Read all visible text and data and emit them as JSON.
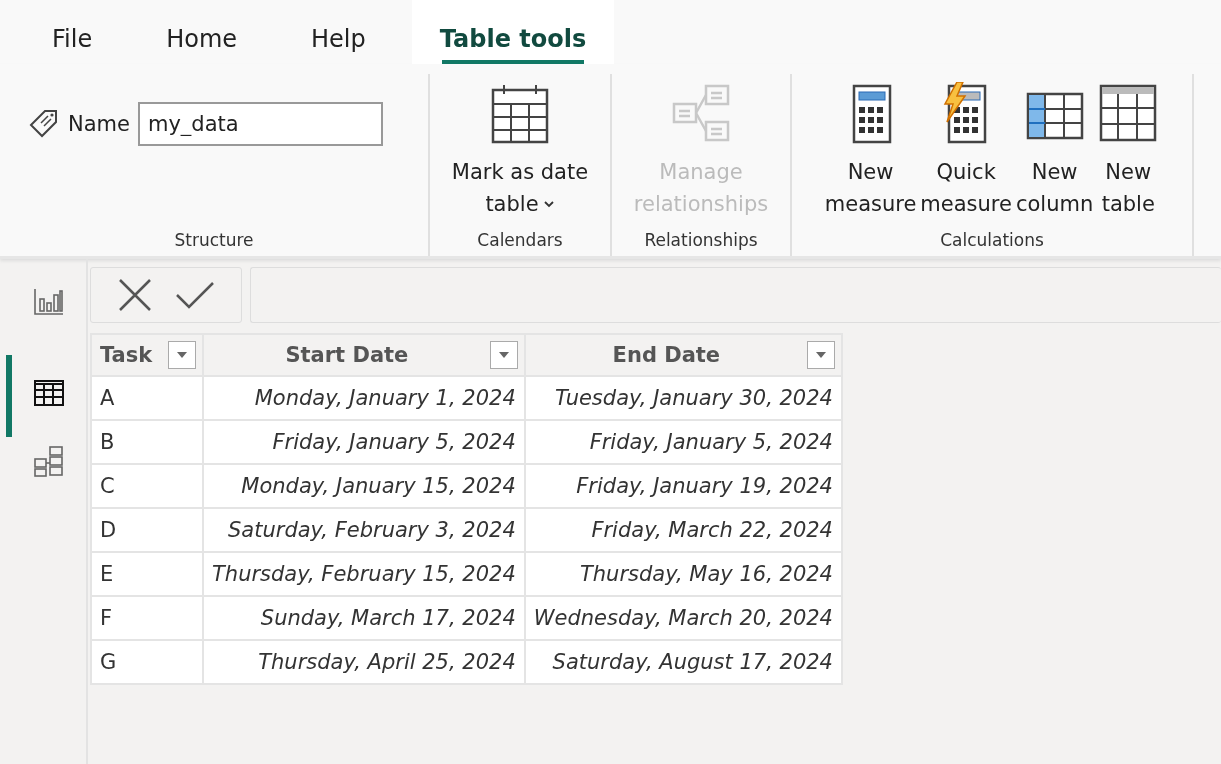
{
  "tabs": [
    {
      "label": "File",
      "selected": false
    },
    {
      "label": "Home",
      "selected": false
    },
    {
      "label": "Help",
      "selected": false
    },
    {
      "label": "Table tools",
      "selected": true
    }
  ],
  "ribbon": {
    "name_label": "Name",
    "name_value": "my_data",
    "groups": [
      {
        "label": "Structure"
      },
      {
        "label": "Calendars",
        "buttons": [
          {
            "kind": "calendar",
            "lines": [
              "Mark as date",
              "table"
            ],
            "dropdown": true,
            "disabled": false
          }
        ]
      },
      {
        "label": "Relationships",
        "buttons": [
          {
            "kind": "relationships",
            "lines": [
              "Manage",
              "relationships"
            ],
            "dropdown": false,
            "disabled": true
          }
        ]
      },
      {
        "label": "Calculations",
        "buttons": [
          {
            "kind": "measure",
            "lines": [
              "New",
              "measure"
            ],
            "dropdown": false,
            "disabled": false
          },
          {
            "kind": "quick-measure",
            "lines": [
              "Quick",
              "measure"
            ],
            "dropdown": false,
            "disabled": false
          },
          {
            "kind": "column",
            "lines": [
              "New",
              "column"
            ],
            "dropdown": false,
            "disabled": false
          },
          {
            "kind": "table",
            "lines": [
              "New",
              "table"
            ],
            "dropdown": false,
            "disabled": false
          }
        ]
      }
    ]
  },
  "nav": [
    {
      "kind": "report",
      "selected": false
    },
    {
      "kind": "table",
      "selected": true
    },
    {
      "kind": "model",
      "selected": false
    }
  ],
  "table": {
    "columns": [
      "Task",
      "Start Date",
      "End Date"
    ],
    "rows": [
      [
        "A",
        "Monday, January 1, 2024",
        "Tuesday, January 30, 2024"
      ],
      [
        "B",
        "Friday, January 5, 2024",
        "Friday, January 5, 2024"
      ],
      [
        "C",
        "Monday, January 15, 2024",
        "Friday, January 19, 2024"
      ],
      [
        "D",
        "Saturday, February 3, 2024",
        "Friday, March 22, 2024"
      ],
      [
        "E",
        "Thursday, February 15, 2024",
        "Thursday, May 16, 2024"
      ],
      [
        "F",
        "Sunday, March 17, 2024",
        "Wednesday, March 20, 2024"
      ],
      [
        "G",
        "Thursday, April 25, 2024",
        "Saturday, August 17, 2024"
      ]
    ]
  }
}
